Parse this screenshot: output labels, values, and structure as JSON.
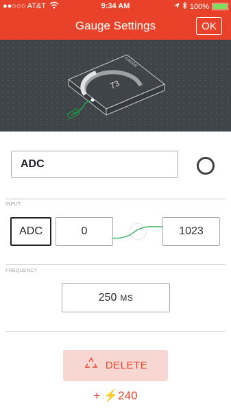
{
  "status_bar": {
    "carrier": "●●○○○ AT&T",
    "time": "9:34 AM",
    "battery": "100%",
    "wifi_icon": "wifi-icon",
    "bluetooth_icon": "bluetooth-icon",
    "location_icon": "location-arrow-icon"
  },
  "nav": {
    "title": "Gauge Settings",
    "ok_label": "OK"
  },
  "preview": {
    "widget_label": "GAUGE",
    "gauge_value": "73",
    "pin_label": "PIN"
  },
  "name": {
    "value": "ADC"
  },
  "input": {
    "section_label": "INPUT",
    "pin": "ADC",
    "min": "0",
    "max": "1023"
  },
  "frequency": {
    "section_label": "FREQUENCY",
    "value": "250",
    "unit": "MS"
  },
  "delete": {
    "label": "DELETE",
    "icon": "recycle-icon"
  },
  "energy": {
    "text": "+ ⚡240"
  },
  "colors": {
    "accent": "#e8432a",
    "dark": "#3e4448",
    "delete_bg": "#f8d6d2",
    "link_green": "#1aa84a"
  }
}
